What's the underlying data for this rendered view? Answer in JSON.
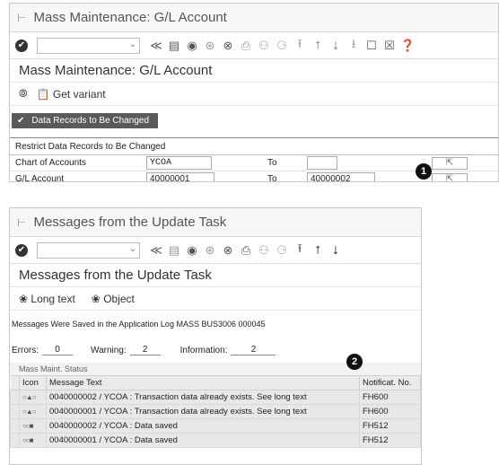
{
  "window1": {
    "title": "Mass Maintenance: G/L Account",
    "screen_title": "Mass Maintenance: G/L Account",
    "app_toolbar": {
      "get_variant": "Get variant"
    },
    "tab_label": "Data Records to Be Changed",
    "group_title": "Restrict Data Records to Be Changed",
    "fields": [
      {
        "label": "Chart of Accounts",
        "from": "YCOA",
        "to_label": "To",
        "to": ""
      },
      {
        "label": "G/L Account",
        "from": "40000001",
        "to_label": "To",
        "to": "40000002"
      }
    ],
    "callout": "1"
  },
  "window2": {
    "title": "Messages from the Update Task",
    "screen_title": "Messages from the Update Task",
    "app_toolbar": {
      "long_text": "Long text",
      "object": "Object"
    },
    "message": "Messages Were Saved in the Application Log MASS BUS3006 000045",
    "counts": {
      "errors_label": "Errors:",
      "errors": "0",
      "warning_label": "Warning:",
      "warning": "2",
      "info_label": "Information:",
      "info": "2"
    },
    "callout": "2",
    "status_header": "Mass Maint. Status",
    "columns": [
      "Icon",
      "Message Text",
      "Notificat. No."
    ],
    "rows": [
      {
        "icon": "warning-status-icon",
        "text": "0040000002 / YCOA : Transaction data already exists. See long text",
        "no": "FH600"
      },
      {
        "icon": "warning-status-icon",
        "text": "0040000001 / YCOA : Transaction data already exists. See long text",
        "no": "FH600"
      },
      {
        "icon": "success-status-icon",
        "text": "0040000002 / YCOA : Data saved",
        "no": "FH512"
      },
      {
        "icon": "success-status-icon",
        "text": "0040000001 / YCOA : Data saved",
        "no": "FH512"
      }
    ]
  }
}
